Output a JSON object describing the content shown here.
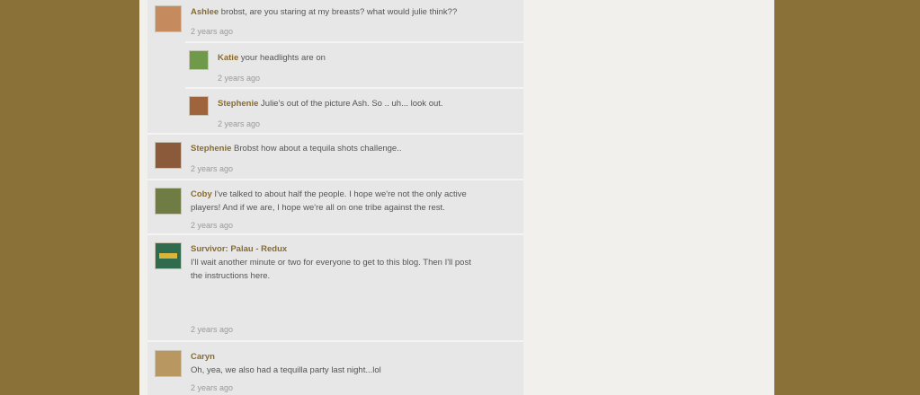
{
  "comments": [
    {
      "author": "Ashlee",
      "body": "brobst, are you staring at my breasts?  what would julie think??",
      "time": "2 years ago"
    },
    {
      "author": "Katie",
      "body": "your headlights are on",
      "time": "2 years ago"
    },
    {
      "author": "Stephenie",
      "body": "Julie's out of the picture Ash. So .. uh... look out.",
      "time": "2 years ago"
    },
    {
      "author": "Stephenie",
      "body": "Brobst how about a tequila shots challenge..",
      "time": "2 years ago"
    },
    {
      "author": "Coby",
      "body": "I've talked to about half the people.  I hope we're not the only active",
      "body2": "players!  And if we are, I hope we're all on one tribe against the rest.",
      "time": "2 years ago"
    },
    {
      "author": "Survivor: Palau - Redux",
      "body": "I'll wait another minute or two for everyone to get to this blog.  Then I'll post",
      "body2": "the instructions here.",
      "time": "2 years ago"
    },
    {
      "author": "Caryn",
      "body": "Oh, yea, we also had a tequilla party last night...lol",
      "time": "2 years ago"
    }
  ],
  "avatar_colors": [
    "#c58a5e",
    "#6f9a4a",
    "#a0643c",
    "#8a5a3a",
    "#6f7d45",
    "#2f6b4c",
    "#b89760"
  ]
}
